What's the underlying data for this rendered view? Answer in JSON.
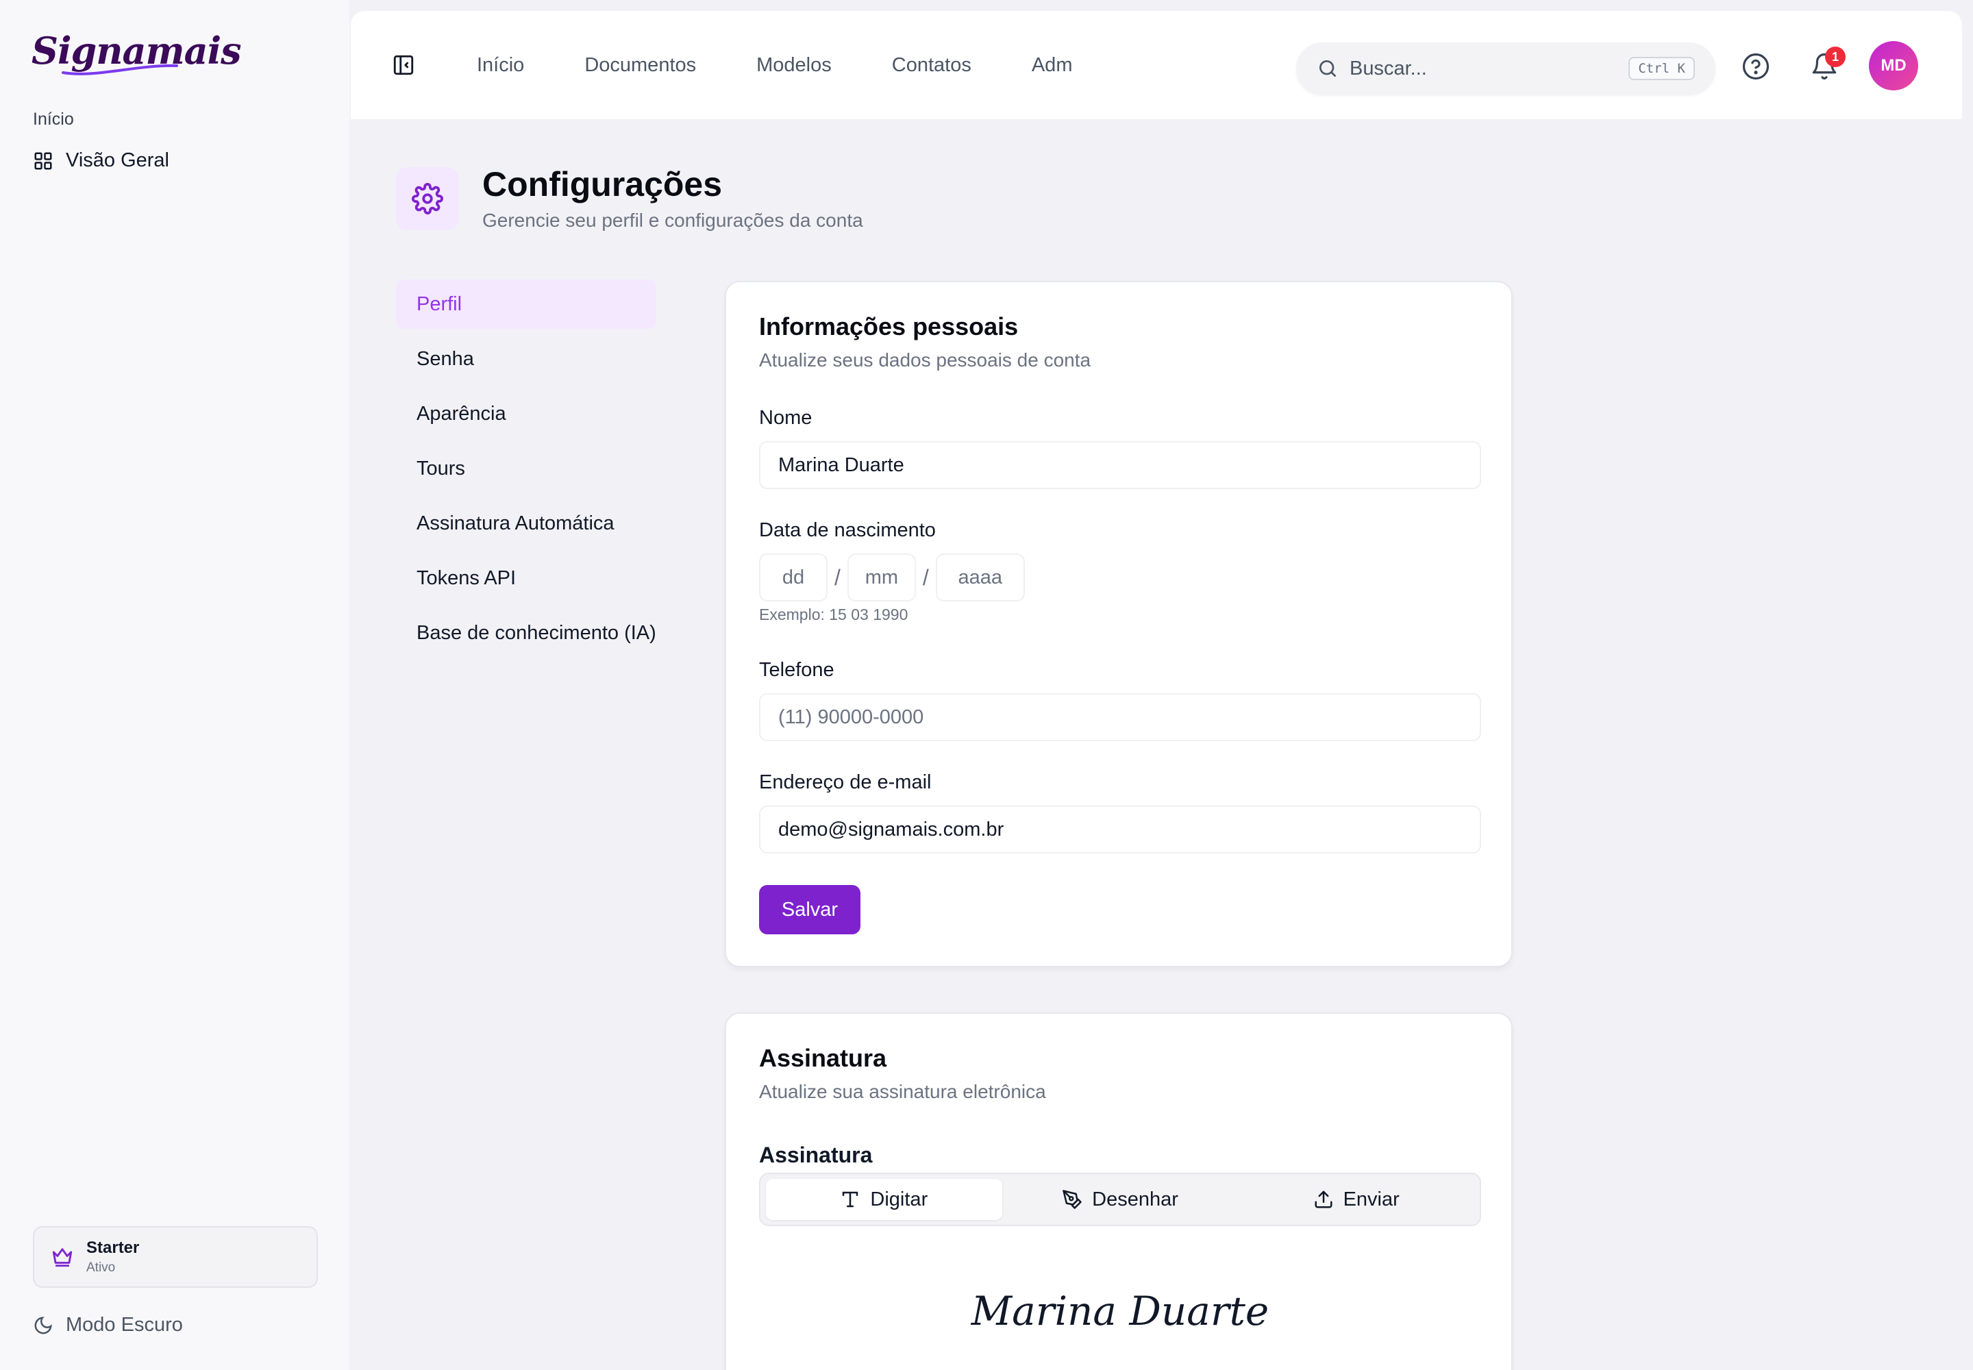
{
  "brand": {
    "logo_text": "Signamais"
  },
  "sidebar": {
    "section_label": "Início",
    "items": [
      {
        "label": "Visão Geral",
        "icon": "grid-icon"
      }
    ],
    "plan": {
      "name": "Starter",
      "status": "Ativo",
      "icon": "crown-icon"
    },
    "dark_mode_label": "Modo Escuro"
  },
  "header": {
    "nav": [
      "Início",
      "Documentos",
      "Modelos",
      "Contatos",
      "Adm"
    ],
    "search": {
      "placeholder": "Buscar...",
      "shortcut": "Ctrl K"
    },
    "notifications_count": "1",
    "avatar_initials": "MD"
  },
  "page": {
    "title": "Configurações",
    "subtitle": "Gerencie seu perfil e configurações da conta"
  },
  "settings_menu": {
    "active": "Perfil",
    "items": [
      "Perfil",
      "Senha",
      "Aparência",
      "Tours",
      "Assinatura Automática",
      "Tokens API",
      "Base de conhecimento (IA)"
    ]
  },
  "personal_info": {
    "title": "Informações pessoais",
    "subtitle": "Atualize seus dados pessoais de conta",
    "name_label": "Nome",
    "name_value": "Marina Duarte",
    "birth_label": "Data de nascimento",
    "birth_day_placeholder": "dd",
    "birth_month_placeholder": "mm",
    "birth_year_placeholder": "aaaa",
    "birth_sep": "/",
    "birth_hint": "Exemplo: 15 03 1990",
    "phone_label": "Telefone",
    "phone_placeholder": "(11) 90000-0000",
    "email_label": "Endereço de e-mail",
    "email_value": "demo@signamais.com.br",
    "save_label": "Salvar"
  },
  "signature": {
    "title": "Assinatura",
    "subtitle": "Atualize sua assinatura eletrônica",
    "field_label": "Assinatura",
    "tabs": [
      {
        "label": "Digitar",
        "icon": "type-icon"
      },
      {
        "label": "Desenhar",
        "icon": "pen-icon"
      },
      {
        "label": "Enviar",
        "icon": "upload-icon"
      }
    ],
    "active_tab": "Digitar",
    "preview_text": "Marina Duarte"
  },
  "colors": {
    "accent": "#7e22ce",
    "accent_light": "#f3e8ff",
    "badge": "#ef2b3a",
    "brand": "#3b0a59"
  }
}
